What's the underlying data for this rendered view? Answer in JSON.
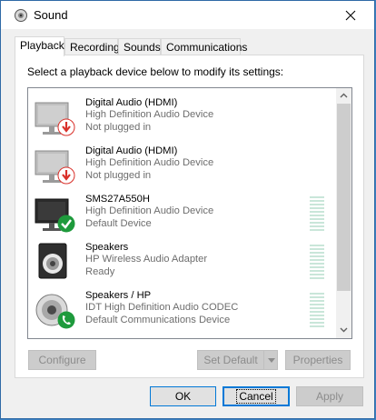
{
  "window": {
    "title": "Sound",
    "close_glyph": "×"
  },
  "tabs": [
    {
      "label": "Playback",
      "active": true
    },
    {
      "label": "Recording",
      "active": false
    },
    {
      "label": "Sounds",
      "active": false
    },
    {
      "label": "Communications",
      "active": false
    }
  ],
  "playback": {
    "instruction": "Select a playback device below to modify its settings:",
    "devices": [
      {
        "name": "Digital Audio (HDMI)",
        "description": "High Definition Audio Device",
        "status": "Not plugged in",
        "icon": "monitor-icon",
        "badge": "red-down-arrow-icon"
      },
      {
        "name": "Digital Audio (HDMI)",
        "description": "High Definition Audio Device",
        "status": "Not plugged in",
        "icon": "monitor-icon",
        "badge": "red-down-arrow-icon"
      },
      {
        "name": "SMS27A550H",
        "description": "High Definition Audio Device",
        "status": "Default Device",
        "icon": "monitor-icon",
        "badge": "green-check-icon"
      },
      {
        "name": "Speakers",
        "description": "HP Wireless Audio Adapter",
        "status": "Ready",
        "icon": "speaker-icon",
        "badge": ""
      },
      {
        "name": "Speakers / HP",
        "description": "IDT High Definition Audio CODEC",
        "status": "Default Communications Device",
        "icon": "speaker-icon",
        "badge": "green-phone-icon"
      }
    ],
    "buttons": {
      "configure": "Configure",
      "set_default": "Set Default",
      "properties": "Properties"
    }
  },
  "dialog_buttons": {
    "ok": "OK",
    "cancel": "Cancel",
    "apply": "Apply"
  },
  "colors": {
    "accent": "#0078d7",
    "badge_red": "#d9302a",
    "badge_green": "#1e9a3c",
    "meter": "#c9e6d9"
  }
}
